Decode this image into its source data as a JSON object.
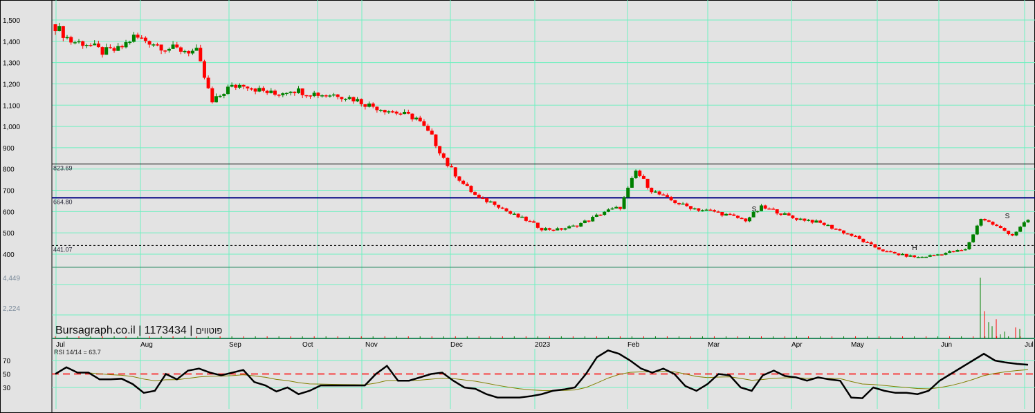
{
  "watermark": {
    "site": "Bursagraph.co.il",
    "security_id": "1173434",
    "name": "פוטווים"
  },
  "colors": {
    "up": "#008000",
    "down": "#ff0000",
    "grid": "#6ff0c0",
    "resistance": "#000080",
    "rsi": "#000000",
    "signal": "#808000",
    "rsi_mid": "#ff0000"
  },
  "chart_data": [
    {
      "type": "candlestick",
      "title": "Price",
      "y_ticks": [
        "1,500",
        "1,400",
        "1,300",
        "1,200",
        "1,100",
        "1,000",
        "900",
        "800",
        "700",
        "600",
        "500",
        "400"
      ],
      "y_tick_values": [
        1500,
        1400,
        1300,
        1200,
        1100,
        1000,
        900,
        800,
        700,
        600,
        500,
        400
      ],
      "ylim": [
        350,
        1590
      ],
      "x_labels": [
        "Jul",
        "Aug",
        "Sep",
        "Oct",
        "Nov",
        "Dec",
        "2023",
        "Feb",
        "Mar",
        "Apr",
        "May",
        "Jun",
        "Jul"
      ],
      "weekly_close": [
        1470,
        1400,
        1390,
        1350,
        1360,
        1420,
        1400,
        1370,
        1360,
        1350,
        1110,
        1180,
        1200,
        1170,
        1150,
        1175,
        1160,
        1150,
        1150,
        1130,
        1100,
        1080,
        1060,
        1040,
        950,
        820,
        730,
        660,
        640,
        590,
        560,
        520,
        515,
        530,
        560,
        600,
        620,
        790,
        700,
        660,
        630,
        610,
        600,
        580,
        560,
        620,
        600,
        570,
        560,
        540,
        510,
        480,
        440,
        410,
        395,
        385,
        395,
        410,
        420,
        570,
        530,
        490,
        560
      ],
      "levels": [
        {
          "value": 823.69,
          "label": "823.69",
          "style": "solid"
        },
        {
          "value": 664.8,
          "label": "664.80",
          "style": "bold"
        },
        {
          "value": 441.07,
          "label": "441.07",
          "style": "dashed"
        }
      ],
      "annotations": [
        "S",
        "S",
        "H"
      ]
    },
    {
      "type": "bar",
      "title": "Volume",
      "y_ticks": [
        "4,449",
        "2,224"
      ],
      "y_tick_values": [
        4449,
        2224
      ],
      "spike_values": [
        4449,
        2000,
        1200,
        900,
        1400,
        300,
        500,
        800,
        700
      ]
    },
    {
      "type": "line",
      "title": "RSI",
      "label": "RSI 14/14 = 63.7",
      "y_ticks": [
        "70",
        "50",
        "30"
      ],
      "y_tick_values": [
        70,
        50,
        30
      ],
      "values": [
        50,
        60,
        52,
        52,
        42,
        42,
        43,
        35,
        22,
        25,
        50,
        42,
        55,
        58,
        52,
        48,
        52,
        56,
        38,
        33,
        24,
        30,
        20,
        25,
        33,
        33,
        33,
        33,
        33,
        50,
        62,
        40,
        40,
        45,
        50,
        52,
        40,
        30,
        28,
        20,
        15,
        15,
        15,
        17,
        20,
        25,
        27,
        30,
        50,
        75,
        85,
        80,
        70,
        58,
        52,
        58,
        50,
        32,
        25,
        35,
        50,
        48,
        30,
        25,
        48,
        55,
        47,
        45,
        40,
        45,
        42,
        40,
        15,
        14,
        30,
        25,
        22,
        22,
        20,
        25,
        40,
        50,
        60,
        70,
        80,
        70,
        67,
        65,
        63.7
      ]
    }
  ]
}
